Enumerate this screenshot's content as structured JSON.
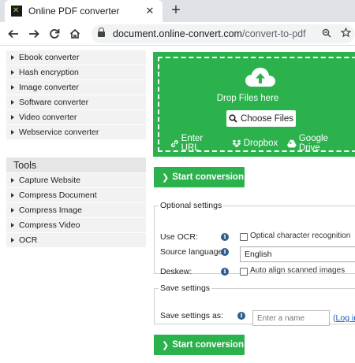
{
  "browser": {
    "tab_title": "Online PDF converter",
    "tab_close": "✕",
    "new_tab": "+",
    "url_host": "document.online-convert.com",
    "url_path": "/convert-to-pdf"
  },
  "sidebar": {
    "items": [
      {
        "label": "Ebook converter"
      },
      {
        "label": "Hash encryption"
      },
      {
        "label": "Image converter"
      },
      {
        "label": "Software converter"
      },
      {
        "label": "Video converter"
      },
      {
        "label": "Webservice converter"
      }
    ],
    "tools_heading": "Tools",
    "tools": [
      {
        "label": "Capture Website"
      },
      {
        "label": "Compress Document"
      },
      {
        "label": "Compress Image"
      },
      {
        "label": "Compress Video"
      },
      {
        "label": "OCR"
      }
    ]
  },
  "upload": {
    "drop_text": "Drop Files here",
    "choose_label": "Choose Files",
    "enter_url": "Enter URL",
    "dropbox": "Dropbox",
    "google_drive": "Google Drive"
  },
  "start_label": "Start conversion",
  "optional": {
    "legend": "Optional settings",
    "use_ocr_label": "Use OCR:",
    "ocr_option": "Optical character recognition",
    "source_language_label": "Source language:",
    "source_language_value": "English",
    "deskew_label": "Deskew:",
    "deskew_option": "Auto align scanned images"
  },
  "save": {
    "legend": "Save settings",
    "save_as_label": "Save settings as:",
    "name_placeholder": "Enter a name",
    "login_prefix": "(",
    "login_link": "Log in"
  },
  "colors": {
    "brand_green": "#2bb24c",
    "info_blue": "#2f5d8f",
    "link_blue": "#1a5fb4"
  }
}
